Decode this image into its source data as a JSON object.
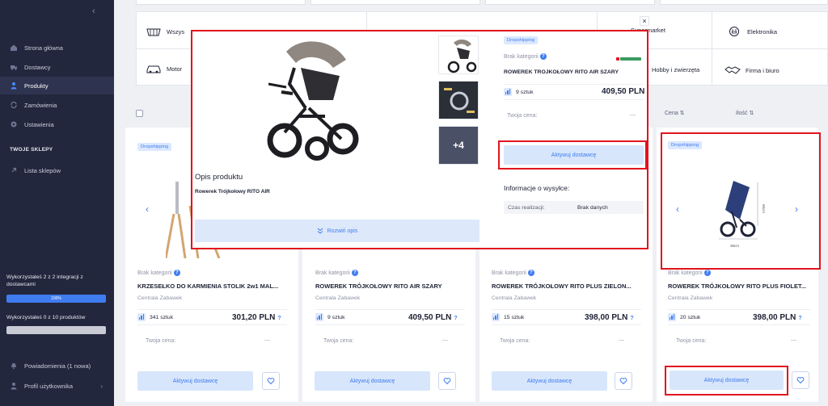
{
  "sidebar": {
    "items": [
      {
        "label": "Strona główna",
        "icon": "home-icon"
      },
      {
        "label": "Dostawcy",
        "icon": "truck-icon"
      },
      {
        "label": "Produkty",
        "icon": "user-icon",
        "active": true
      },
      {
        "label": "Zamówienia",
        "icon": "refresh-icon"
      },
      {
        "label": "Ustawienia",
        "icon": "gear-icon"
      }
    ],
    "shops_heading": "TWOJE SKLEPY",
    "shops_item": "Lista sklepów",
    "integrations_usage": "Wykorzystałeś 2 z 2 integracji z dostawcami",
    "integrations_percent_label": "100%",
    "integrations_progress": 1.0,
    "products_usage": "Wykorzystałeś 0 z 10 produktów",
    "products_progress": 0.0,
    "notifications": "Powiadomienia (1 nowa)",
    "profile": "Profil użytkownika"
  },
  "categories": {
    "c1": "Wszys",
    "c2": "Motor",
    "supermarket": "Supermarket",
    "electronics": "Elektronika",
    "hobby": "Hobby i zwierzęta",
    "company": "Firma i biuro"
  },
  "columns": {
    "price": "Cena ⇅",
    "quantity": "Ilość ⇅"
  },
  "cards": [
    {
      "badge": "Dropshipping",
      "category": "Brak kategorii",
      "title": "KRZESEŁKO DO KARMIENIA STOLIK 2w1 MAL...",
      "supplier": "Centrala Zabawek",
      "stock": "341 sztuk",
      "price": "301,20 PLN",
      "your_price_label": "Twoja cena:",
      "your_price": "---",
      "cta": "Aktywuj dostawcę"
    },
    {
      "badge": "Dropshipping",
      "category": "Brak kategorii",
      "title": "ROWEREK TRÓJKOŁOWY RITO AIR SZARY",
      "supplier": "Centrala Zabawek",
      "stock": "9 sztuk",
      "price": "409,50 PLN",
      "your_price_label": "Twoja cena:",
      "your_price": "---",
      "cta": "Aktywuj dostawcę"
    },
    {
      "badge": "Dropshipping",
      "category": "Brak kategorii",
      "title": "ROWEREK TRÓJKOŁOWY RITO PLUS ZIELON...",
      "supplier": "Centrala Zabawek",
      "stock": "15 sztuk",
      "price": "398,00 PLN",
      "your_price_label": "Twoja cena:",
      "your_price": "---",
      "cta": "Aktywuj dostawcę"
    },
    {
      "badge": "Dropshipping",
      "category": "Brak kategorii",
      "title": "ROWEREK TRÓJKOŁOWY RITO PLUS FIOLET...",
      "supplier": "Centrala Zabawek",
      "stock": "20 sztuk",
      "price": "398,00 PLN",
      "your_price_label": "Twoja cena:",
      "your_price": "---",
      "cta": "Aktywuj dostawcę"
    }
  ],
  "card4_dims": {
    "height": "60cm",
    "width": "38cm"
  },
  "modal": {
    "close": "×",
    "more_images": "+4",
    "description_heading": "Opis produktu",
    "description_text": "Rowerek Trójkołowy RITO AIR",
    "expand": "Rozwiń opis",
    "badge": "Dropshipping",
    "category": "Brak kategorii",
    "title": "ROWEREK TRÓJKOŁOWY RITO AIR SZARY",
    "stock": "9 sztuk",
    "price": "409,50 PLN",
    "your_price_label": "Twoja cena:",
    "your_price": "---",
    "cta": "Aktywuj dostawcę",
    "shipping_heading": "Informacje o wysyłce:",
    "lead_time_label": "Czas realizacji:",
    "lead_time_value": "Brak danych"
  },
  "colors": {
    "accent": "#3f7cf0",
    "sidebar": "#23273d",
    "highlight": "#e0141e",
    "button_bg": "#d7e6fb"
  }
}
